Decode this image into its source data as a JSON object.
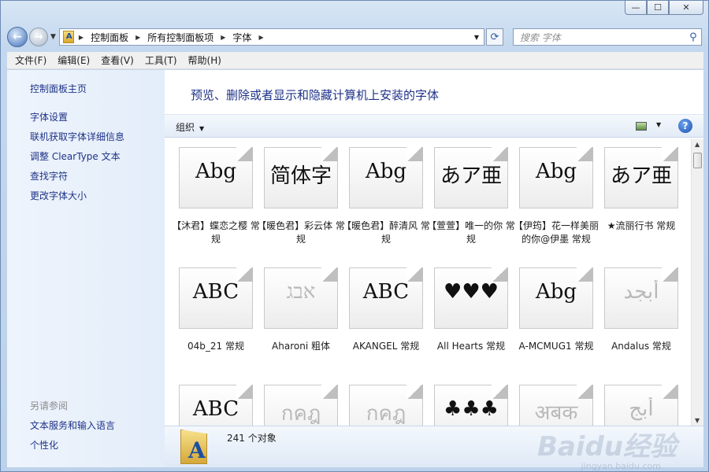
{
  "window": {
    "controls": {
      "minimize": "—",
      "maximize": "☐",
      "close": "✕"
    }
  },
  "nav": {
    "back_icon": "back-arrow-icon",
    "forward_icon": "forward-arrow-icon",
    "breadcrumb": [
      "控制面板",
      "所有控制面板项",
      "字体"
    ],
    "search_placeholder": "搜索 字体"
  },
  "menu": [
    "文件(F)",
    "编辑(E)",
    "查看(V)",
    "工具(T)",
    "帮助(H)"
  ],
  "sidebar": {
    "home": "控制面板主页",
    "links": [
      "字体设置",
      "联机获取字体详细信息",
      "调整 ClearType 文本",
      "查找字符",
      "更改字体大小"
    ],
    "see_also": "另请参阅",
    "see_also_links": [
      "文本服务和输入语言",
      "个性化"
    ]
  },
  "main": {
    "heading": "预览、删除或者显示和隐藏计算机上安装的字体",
    "organize": "组织",
    "fonts": [
      {
        "preview": "Abg",
        "name": "【沐君】蝶恋之樱 常规",
        "faded": false
      },
      {
        "preview": "简体字",
        "name": "【暖色君】彩云体 常规",
        "faded": false
      },
      {
        "preview": "Abg",
        "name": "【暖色君】醉清风 常规",
        "faded": false
      },
      {
        "preview": "あア亜",
        "name": "【萱萱】唯一的你 常规",
        "faded": false
      },
      {
        "preview": "Abg",
        "name": "【伊筠】花一样美丽的你@伊墨 常规",
        "faded": false
      },
      {
        "preview": "あア亜",
        "name": "★流丽行书 常规",
        "faded": false
      },
      {
        "preview": "ABC",
        "name": "04b_21 常规",
        "faded": false
      },
      {
        "preview": "אבג",
        "name": "Aharoni 粗体",
        "faded": true
      },
      {
        "preview": "ABC",
        "name": "AKANGEL 常规",
        "faded": false
      },
      {
        "preview": "♥♥♥",
        "name": "All Hearts 常规",
        "faded": false
      },
      {
        "preview": "Abg",
        "name": "A-MCMUG1 常规",
        "faded": false
      },
      {
        "preview": "أبجد",
        "name": "Andalus 常规",
        "faded": true
      },
      {
        "preview": "ABC",
        "name": "",
        "faded": false
      },
      {
        "preview": "กคฎ",
        "name": "",
        "faded": true
      },
      {
        "preview": "กคฎ",
        "name": "",
        "faded": true
      },
      {
        "preview": "♣♣♣",
        "name": "",
        "faded": false
      },
      {
        "preview": "अबक",
        "name": "",
        "faded": true
      },
      {
        "preview": "أبج",
        "name": "",
        "faded": true
      }
    ]
  },
  "status": {
    "count": "241 个对象"
  },
  "watermark": {
    "text": "Baidu经验",
    "url": "jingyan.baidu.com"
  }
}
